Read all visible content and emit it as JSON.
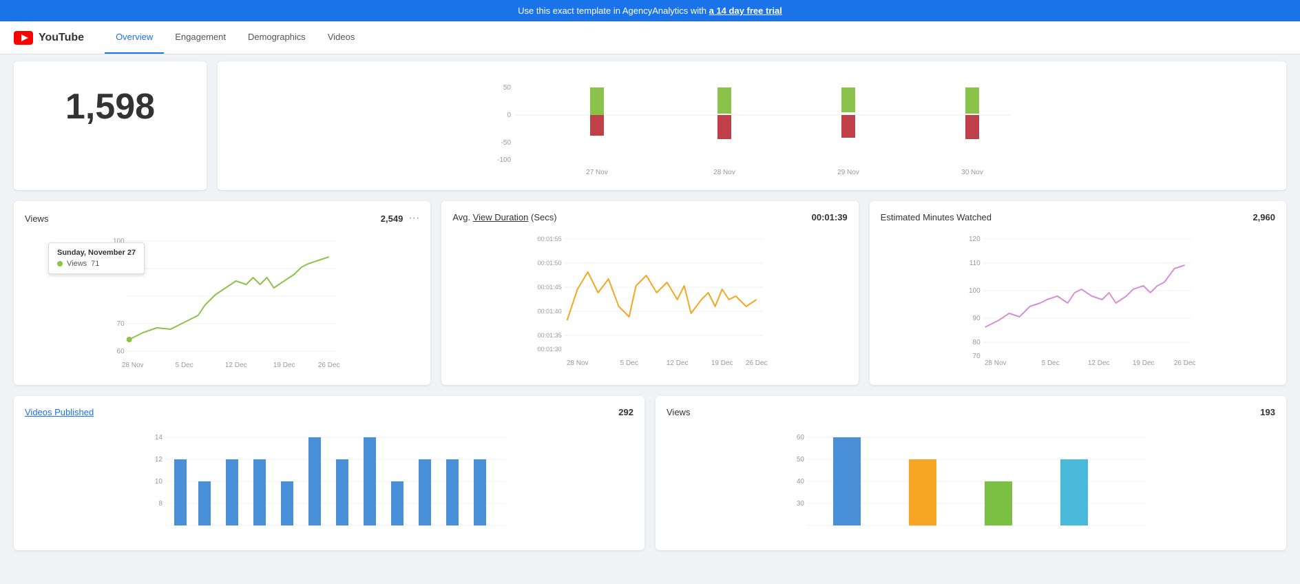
{
  "banner": {
    "text": "Use this exact template in AgencyAnalytics with ",
    "link_text": "a 14 day free trial",
    "link_url": "#"
  },
  "navbar": {
    "brand": "YouTube",
    "tabs": [
      {
        "label": "Overview",
        "active": true
      },
      {
        "label": "Engagement",
        "active": false
      },
      {
        "label": "Demographics",
        "active": false
      },
      {
        "label": "Videos",
        "active": false
      }
    ]
  },
  "top_left_card": {
    "value": "1,598"
  },
  "top_right_card": {
    "y_axis": [
      "50",
      "0",
      "-50",
      "-100"
    ],
    "x_labels": [
      "27 Nov",
      "28 Nov",
      "29 Nov",
      "30 Nov"
    ]
  },
  "views_card": {
    "title": "Views",
    "value": "2,549",
    "y_axis": [
      "100",
      "90",
      "70",
      "60"
    ],
    "x_labels": [
      "28 Nov",
      "5 Dec",
      "12 Dec",
      "19 Dec",
      "26 Dec"
    ],
    "tooltip": {
      "date": "Sunday, November 27",
      "metric": "Views",
      "value": "71"
    }
  },
  "avg_view_card": {
    "title": "Avg. View Duration (Secs)",
    "value": "00:01:39",
    "y_axis": [
      "00:01:55",
      "00:01:50",
      "00:01:45",
      "00:01:40",
      "00:01:35",
      "00:01:30"
    ],
    "x_labels": [
      "28 Nov",
      "5 Dec",
      "12 Dec",
      "19 Dec",
      "26 Dec"
    ]
  },
  "est_minutes_card": {
    "title": "Estimated Minutes Watched",
    "value": "2,960",
    "y_axis": [
      "120",
      "110",
      "100",
      "90",
      "80",
      "70"
    ],
    "x_labels": [
      "28 Nov",
      "5 Dec",
      "12 Dec",
      "19 Dec",
      "26 Dec"
    ]
  },
  "videos_published_card": {
    "title": "Videos Published",
    "value": "292",
    "y_axis": [
      "14",
      "12",
      "10",
      "8"
    ],
    "x_labels": []
  },
  "views_bottom_card": {
    "title": "Views",
    "value": "193",
    "y_axis": [
      "60",
      "50",
      "40",
      "30"
    ],
    "x_labels": []
  }
}
